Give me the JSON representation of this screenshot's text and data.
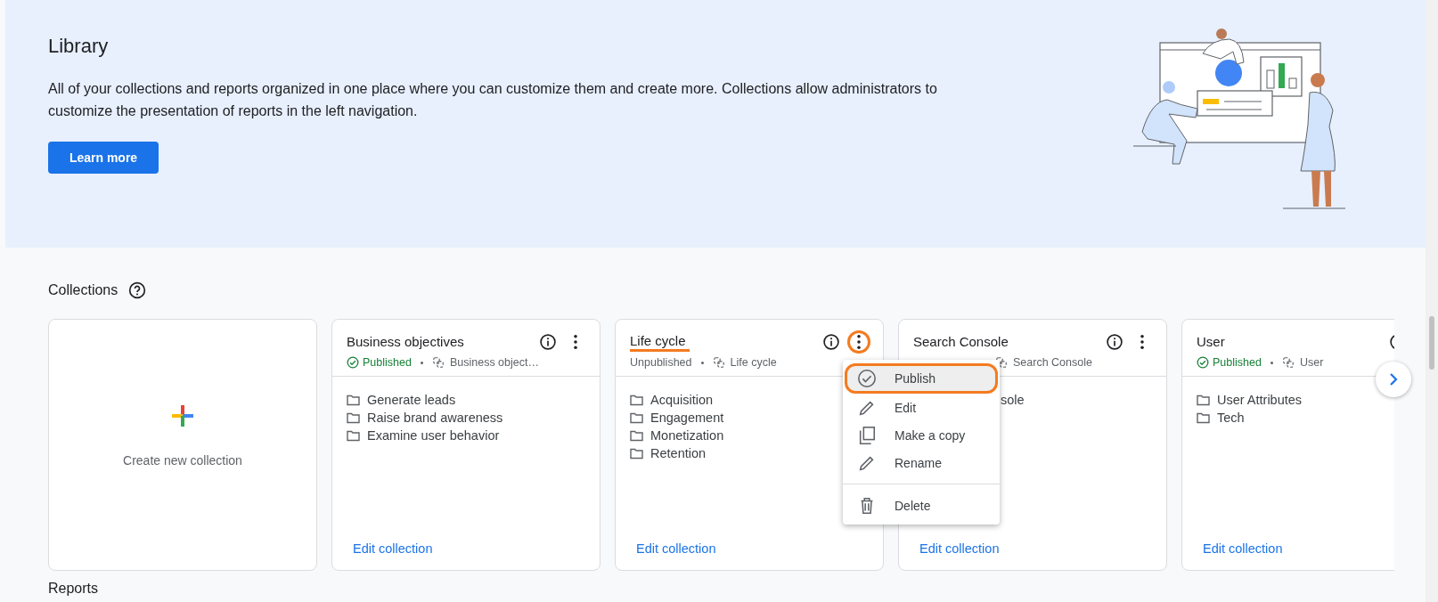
{
  "banner": {
    "title": "Library",
    "description": "All of your collections and reports organized in one place where you can customize them and create more. Collections allow administrators to customize the presentation of reports in the left navigation.",
    "button": "Learn more"
  },
  "collections": {
    "heading": "Collections",
    "create_label": "Create new collection",
    "cards": [
      {
        "title": "Business objectives",
        "title_marked": false,
        "actions": [
          {
            "kind": "info"
          },
          {
            "kind": "more"
          }
        ],
        "menu_open": false,
        "status": {
          "label": "Published",
          "kind": "published"
        },
        "source": "Business object…",
        "items": [
          {
            "text": "Generate leads",
            "icon": true
          },
          {
            "text": "Raise brand awareness",
            "icon": true
          },
          {
            "text": "Examine user behavior",
            "icon": true
          }
        ],
        "link": "Edit collection"
      },
      {
        "title": "Life cycle",
        "title_marked": true,
        "actions": [
          {
            "kind": "info"
          },
          {
            "kind": "more"
          }
        ],
        "menu_open": true,
        "status": {
          "label": "Unpublished",
          "kind": "unpublished"
        },
        "source": "Life cycle",
        "items": [
          {
            "text": "Acquisition",
            "icon": true
          },
          {
            "text": "Engagement",
            "icon": true
          },
          {
            "text": "Monetization",
            "icon": true
          },
          {
            "text": "Retention",
            "icon": true
          }
        ],
        "link": "Edit collection"
      },
      {
        "title": "Search Console",
        "title_marked": false,
        "actions": [
          {
            "kind": "info"
          },
          {
            "kind": "more"
          }
        ],
        "menu_open": false,
        "source": "Search Console",
        "items": [
          {
            "text": "sole",
            "icon": false
          }
        ],
        "link": "Edit collection"
      },
      {
        "title": "User",
        "title_marked": false,
        "actions": [
          {
            "kind": "info"
          }
        ],
        "menu_open": false,
        "status": {
          "label": "Published",
          "kind": "published"
        },
        "source": "User",
        "items": [
          {
            "text": "User Attributes",
            "icon": true
          },
          {
            "text": "Tech",
            "icon": true
          }
        ],
        "link": "Edit collection"
      }
    ]
  },
  "menu": {
    "items": [
      {
        "label": "Publish",
        "kind": "publish",
        "highlighted": true
      },
      {
        "label": "Edit",
        "kind": "edit",
        "highlighted": false
      },
      {
        "label": "Make a copy",
        "kind": "copy",
        "highlighted": false
      },
      {
        "label": "Rename",
        "kind": "rename",
        "highlighted": false
      },
      {
        "label": "Delete",
        "kind": "delete",
        "highlighted": false
      }
    ]
  },
  "reports": {
    "heading": "Reports"
  }
}
